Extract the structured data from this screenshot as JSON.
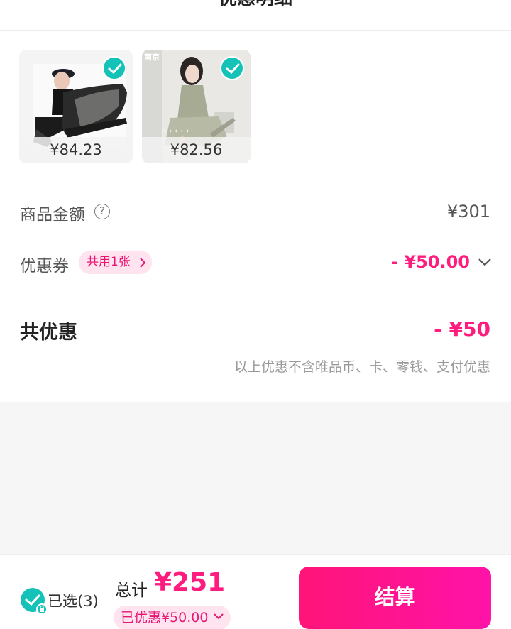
{
  "header": {
    "title": "优惠明细"
  },
  "products": [
    {
      "price": "¥84.23",
      "checked": true
    },
    {
      "price": "¥82.56",
      "checked": true,
      "brand": "南京"
    }
  ],
  "summary": {
    "goods_label": "商品金额",
    "goods_value": "¥301",
    "help_symbol": "?",
    "coupon_label": "优惠券",
    "coupon_badge": "共用1张",
    "coupon_value": "- ¥50.00",
    "total_discount_label": "共优惠",
    "total_discount_value": "- ¥50",
    "note": "以上优惠不含唯品币、卡、零钱、支付优惠"
  },
  "footer": {
    "selected_label": "已选(3)",
    "sum_label": "总计",
    "sum_value": "¥251",
    "saved_label": "已优惠¥50.00",
    "checkout_label": "结算"
  },
  "colors": {
    "accent": "#ff1c7f",
    "teal": "#14c2b8",
    "pill_bg": "#ffe4ef"
  }
}
